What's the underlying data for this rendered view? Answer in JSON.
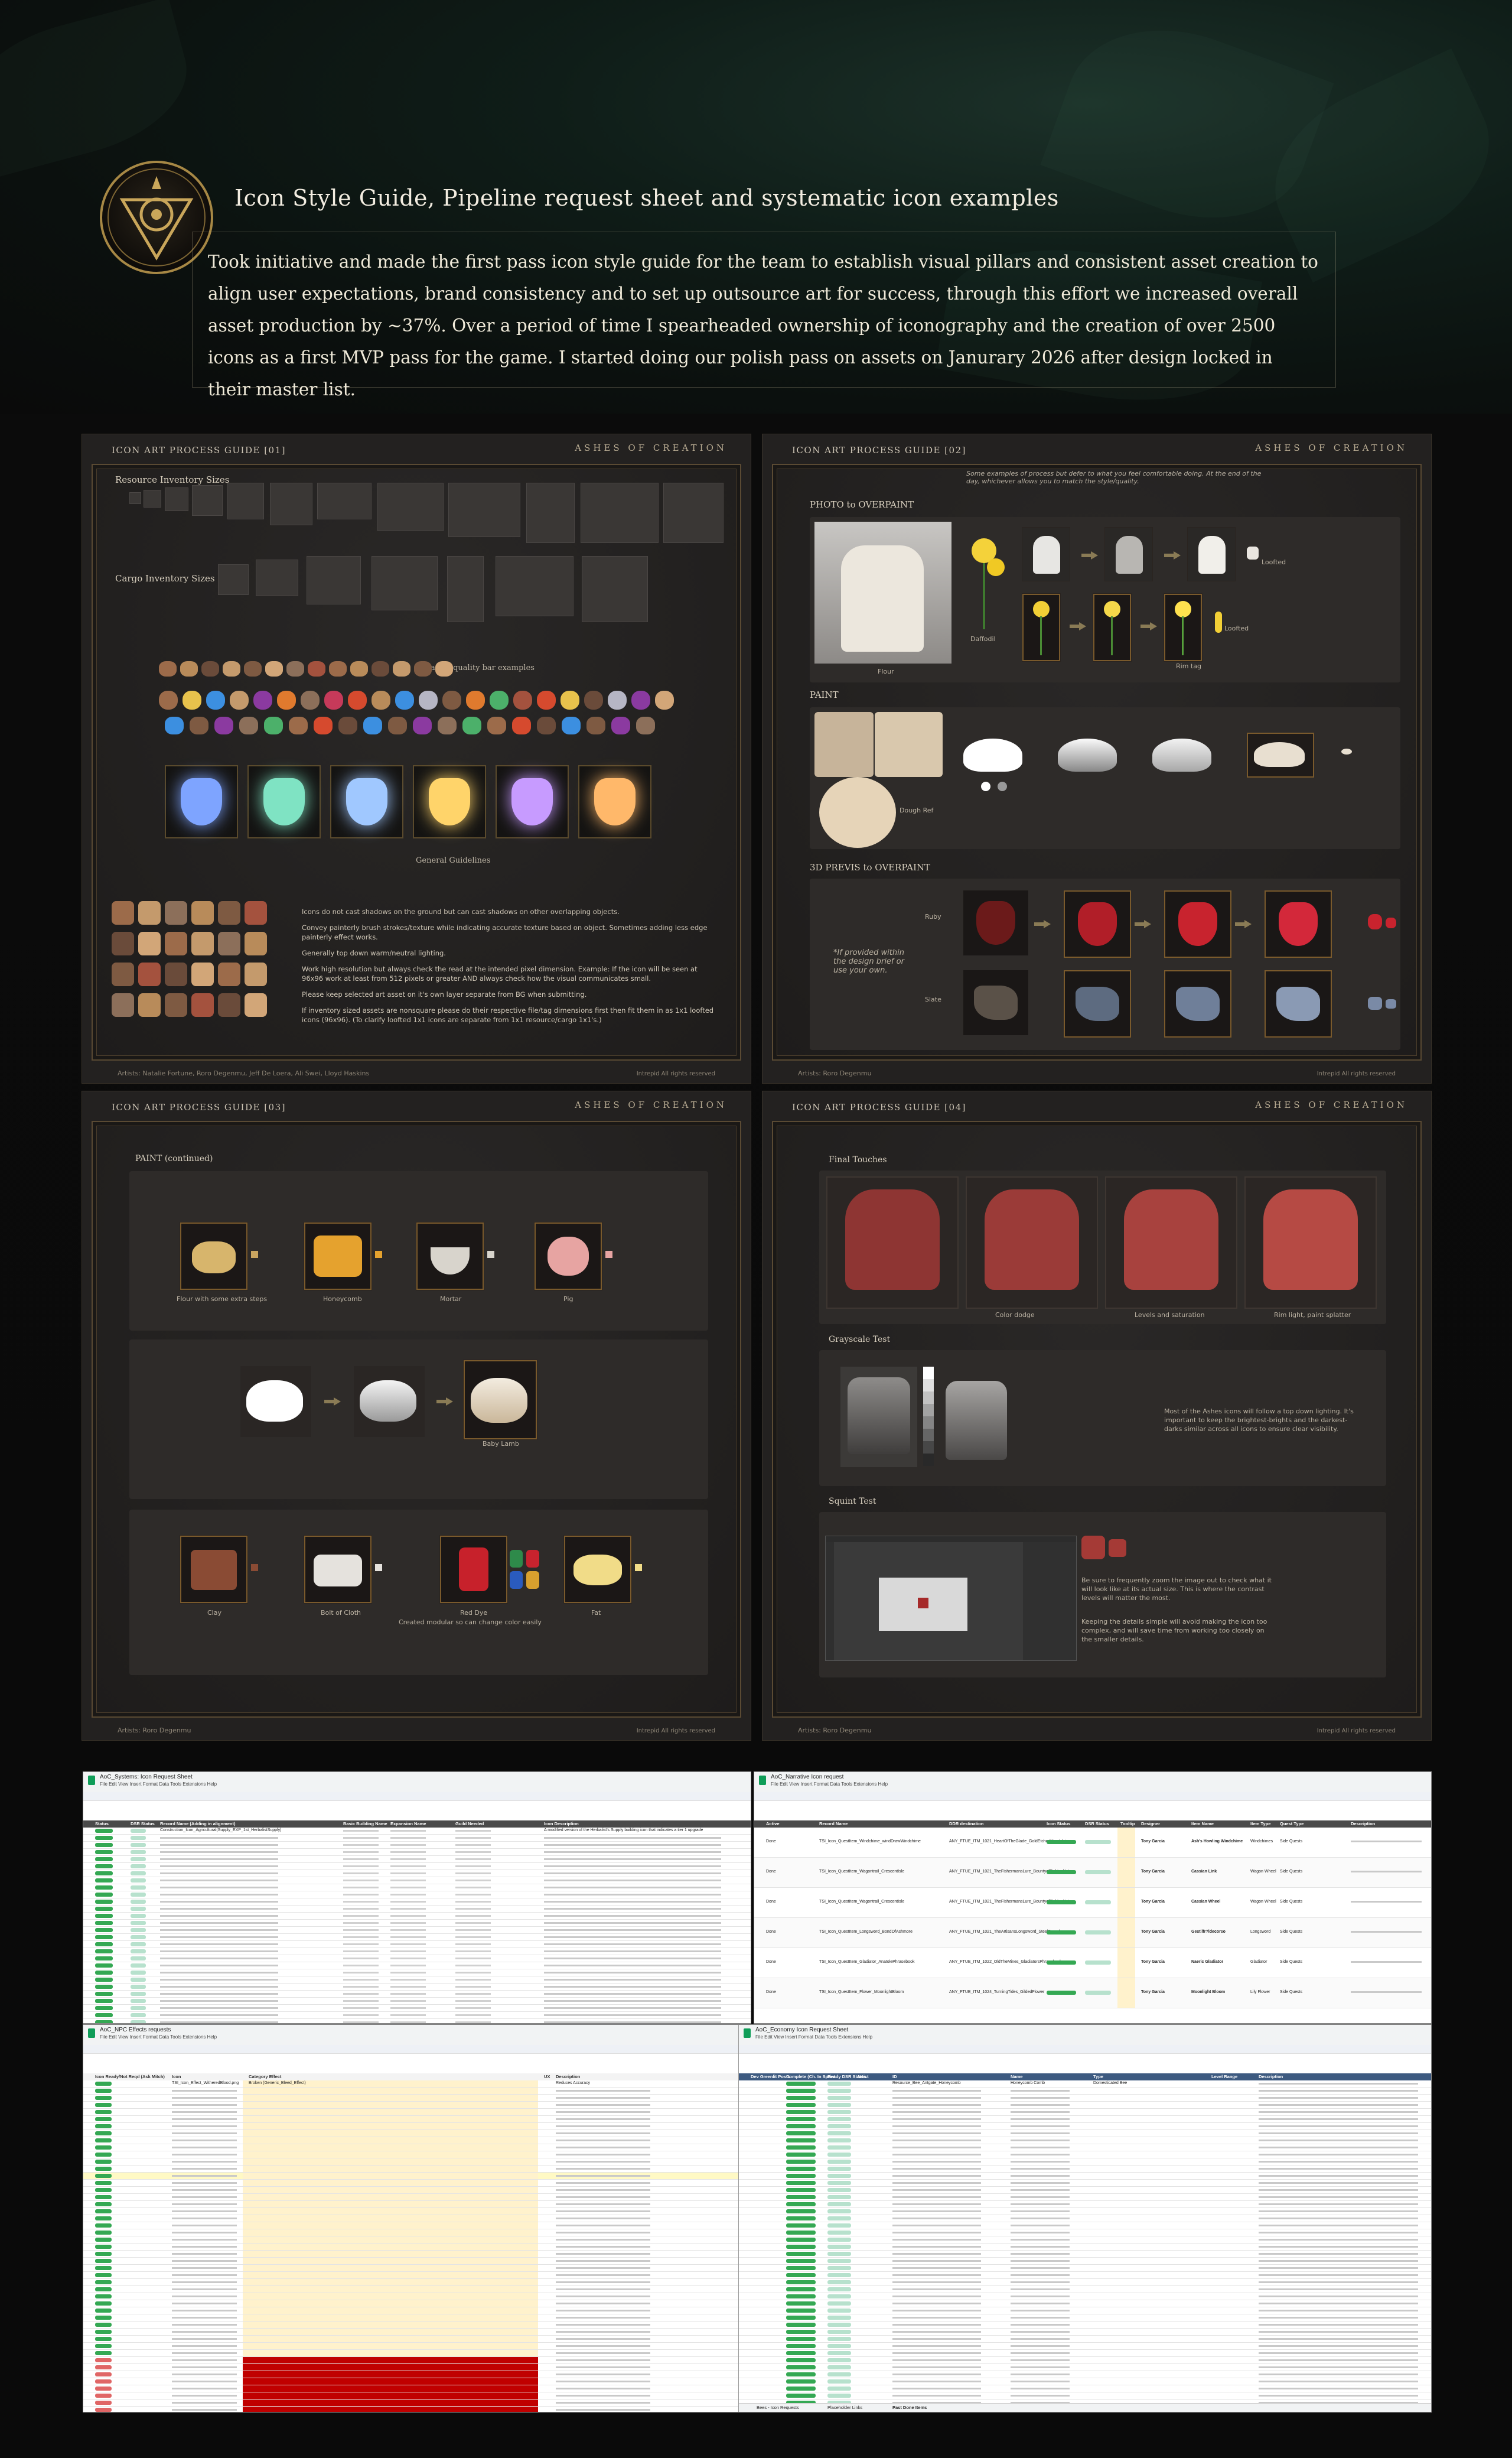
{
  "header": {
    "title": "Icon Style Guide, Pipeline request sheet and systematic icon examples",
    "body": "Took initiative and made the first pass icon style guide for the team to establish visual pillars and consistent asset creation to align user expectations, brand consistency and to set up outsource art for success, through this effort we increased overall asset production by ~37%. Over a period of time I spearheaded ownership of iconography and the creation of over 2500 icons as a first MVP pass for the game. I started doing our polish pass on assets on Janurary 2026 after design locked in their master list."
  },
  "brand": "ASHES OF CREATION",
  "copyright": "Intrepid  All rights reserved",
  "guide1": {
    "title": "ICON ART PROCESS GUIDE [01]",
    "resource_label": "Resource Inventory Sizes",
    "cargo_label": "Cargo Inventory Sizes",
    "quality_label": "Art asset quality bar examples",
    "guidelines_label": "General Guidelines",
    "guidelines": [
      "Icons do not cast shadows on the ground but can cast shadows on other overlapping objects.",
      "Convey painterly brush strokes/texture while indicating accurate texture based on object. Sometimes adding less edge painterly effect works.",
      "Generally top down warm/neutral lighting.",
      "Work high resolution but always check the read at the intended pixel dimension. Example: If the icon will be seen at 96x96 work at least from 512 pixels or greater AND always check how the visual communicates small.",
      "Please keep selected art asset on it's own layer separate from BG when submitting.",
      "If inventory sized assets are nonsquare please do their respective file/tag dimensions first then fit them in as 1x1 loofted icons (96x96). (To clarify loofted 1x1 icons are separate from 1x1 resource/cargo 1x1's.)"
    ],
    "artists": "Artists: Natalie Fortune, Roro Degenmu, Jeff De Loera, Ali Swei, Lloyd Haskins"
  },
  "guide2": {
    "title": "ICON ART PROCESS GUIDE [02]",
    "note": "Some examples of process but defer to what you feel comfortable doing. At the end of the day, whichever allows you to match the style/quality.",
    "photo_label": "PHOTO to OVERPAINT",
    "flour": "Flour",
    "daffodil": "Daffodil",
    "loofted": "Loofted",
    "loofted2": "Loofted",
    "rim_tag": "Rim tag",
    "paint_label": "PAINT",
    "dough_ref": "Dough Ref",
    "previs_label": "3D PREVIS to OVERPAINT",
    "previs_note": "*If provided within the design brief or use your own.",
    "ruby": "Ruby",
    "slate": "Slate",
    "artists": "Artists: Roro Degenmu"
  },
  "guide3": {
    "title": "ICON ART PROCESS GUIDE [03]",
    "paint_label": "PAINT (continued)",
    "items": [
      "Flour with some extra steps",
      "Honeycomb",
      "Mortar",
      "Pig"
    ],
    "lamb": "Baby Lamb",
    "row3": [
      "Clay",
      "Bolt of Cloth",
      "Red Dye",
      "Fat"
    ],
    "modular": "Created modular so can change color easily",
    "artists": "Artists: Roro Degenmu"
  },
  "guide4": {
    "title": "ICON ART PROCESS GUIDE [04]",
    "final_label": "Final Touches",
    "shirt_labels": [
      "",
      "Color dodge",
      "Levels and saturation",
      "Rim light, paint splatter"
    ],
    "grayscale_label": "Grayscale Test",
    "grayscale_text": "Most of the Ashes icons will follow a top down lighting. It's important to keep the brightest-brights and the darkest-darks similar across all icons to ensure clear visibility.",
    "squint_label": "Squint Test",
    "squint_text1": "Be sure to frequently zoom the image out to check what it will look like at its actual size. This is where the contrast levels will matter the most.",
    "squint_text2": "Keeping the details simple will avoid making the icon too complex, and will save time from working too closely on the smaller details.",
    "artists": "Artists: Roro Degenmu"
  },
  "sheets": {
    "s1": {
      "title": "AoC_Systems: Icon Request Sheet",
      "menus": "File  Edit  View  Insert  Format  Data  Tools  Extensions  Help",
      "headers": [
        "Status",
        "DSR Status",
        "Record Name (Adding in alignment)",
        "Basic Building Name",
        "Expansion Name",
        "Guild Needed",
        "Icon Description"
      ],
      "sample_rows": [
        "Construction_Icon_Agricultural(Supply_EXP_1st_HerbalistSupply)",
        "A modified version of the Herbalist's Supply building icon that indicates a tier 1 upgrade"
      ]
    },
    "s2": {
      "title": "AoC_Narrative Icon request",
      "menus": "File  Edit  View  Insert  Format  Data  Tools  Extensions  Help",
      "headers": [
        "Active",
        "Record Name",
        "DDR destination",
        "Icon Status",
        "DSR Status",
        "Tooltip",
        "Designer",
        "Item Name",
        "Item Type",
        "Quest Type",
        "Description"
      ],
      "rows": [
        [
          "Done",
          "TSI_Icon_QuestItem_Windchime_windDrawWindchime",
          "ANY_FTUE_ITM_1021_HeartOfTheGlade_GoldEtchedHandchime",
          "Complete",
          "Included",
          "Tony Garcia",
          "Ash's Howling Windchime",
          "Windchimes",
          "Side Quests"
        ],
        [
          "Done",
          "TSI_Icon_QuestItem_Wagontrail_CrescentIsle",
          "ANY_FTUE_ITM_1021_TheFishermansLure_BountyofFishingNet",
          "Complete",
          "Included",
          "Tony Garcia",
          "Cassian Link",
          "Wagon Wheel",
          "Side Quests"
        ],
        [
          "Done",
          "TSI_Icon_QuestItem_Wagontrail_CrescentIsle",
          "ANY_FTUE_ITM_1021_TheFishermansLure_BountyofFishingNet",
          "Complete",
          "Included",
          "Tony Garcia",
          "Cassian Wheel",
          "Wagon Wheel",
          "Side Quests"
        ],
        [
          "Done",
          "TSI_Icon_QuestItem_Longsword_BondOfAshmore",
          "ANY_FTUE_ITM_1021_TheArtisansLongsword_SteelSword",
          "Complete",
          "Included",
          "Tony Garcia",
          "Gestilfr?ldecorso",
          "Longsword",
          "Side Quests"
        ],
        [
          "Done",
          "TSI_Icon_QuestItem_Gladiator_AnatolePhrasebook",
          "ANY_FTUE_ITM_1022_OldTheMines_GladiatorsPhrasebook",
          "Complete",
          "Included",
          "Tony Garcia",
          "Naeric Gladiator",
          "Gladiator",
          "Side Quests"
        ],
        [
          "Done",
          "TSI_Icon_QuestItem_Flower_MoonlightBloom",
          "ANY_FTUE_ITM_1024_TurningTides_GildedFlower",
          "Complete",
          "Included",
          "Tony Garcia",
          "Moonlight Bloom",
          "Lily Flower",
          "Side Quests"
        ]
      ]
    },
    "s3": {
      "title": "AoC_NPC Effects requests",
      "menus": "File  Edit  View  Insert  Format  Data  Tools  Extensions  Help",
      "headers": [
        "Icon Ready/Not Reqd (Ask Mitch)",
        "Icon",
        "Category Effect",
        "UX",
        "Description"
      ],
      "sample_rows": [
        "TSI_Icon_Effect_WitheredBlood.png",
        "Broken (Generic_Bleed_Effect)",
        "Reduces Accuracy"
      ]
    },
    "s4": {
      "title": "AoC_Economy Icon Request Sheet",
      "menus": "File  Edit  View  Insert  Format  Data  Tools  Extensions  Help",
      "headers": [
        "Dev Greenlit Posts",
        "Complete (Ch. In Sprint",
        "Ready DSR Status",
        "Artist",
        "ID",
        "Name",
        "Type",
        "Level Range",
        "Description"
      ],
      "sample_rows": [
        "Resource_Bee_Antgate_Honeycomb",
        "Honeycomb Comb",
        "Domesticated Bee"
      ],
      "tabs": [
        "Bees - Icon Requests",
        "Placeholder Links",
        "Past Done Items"
      ]
    }
  }
}
